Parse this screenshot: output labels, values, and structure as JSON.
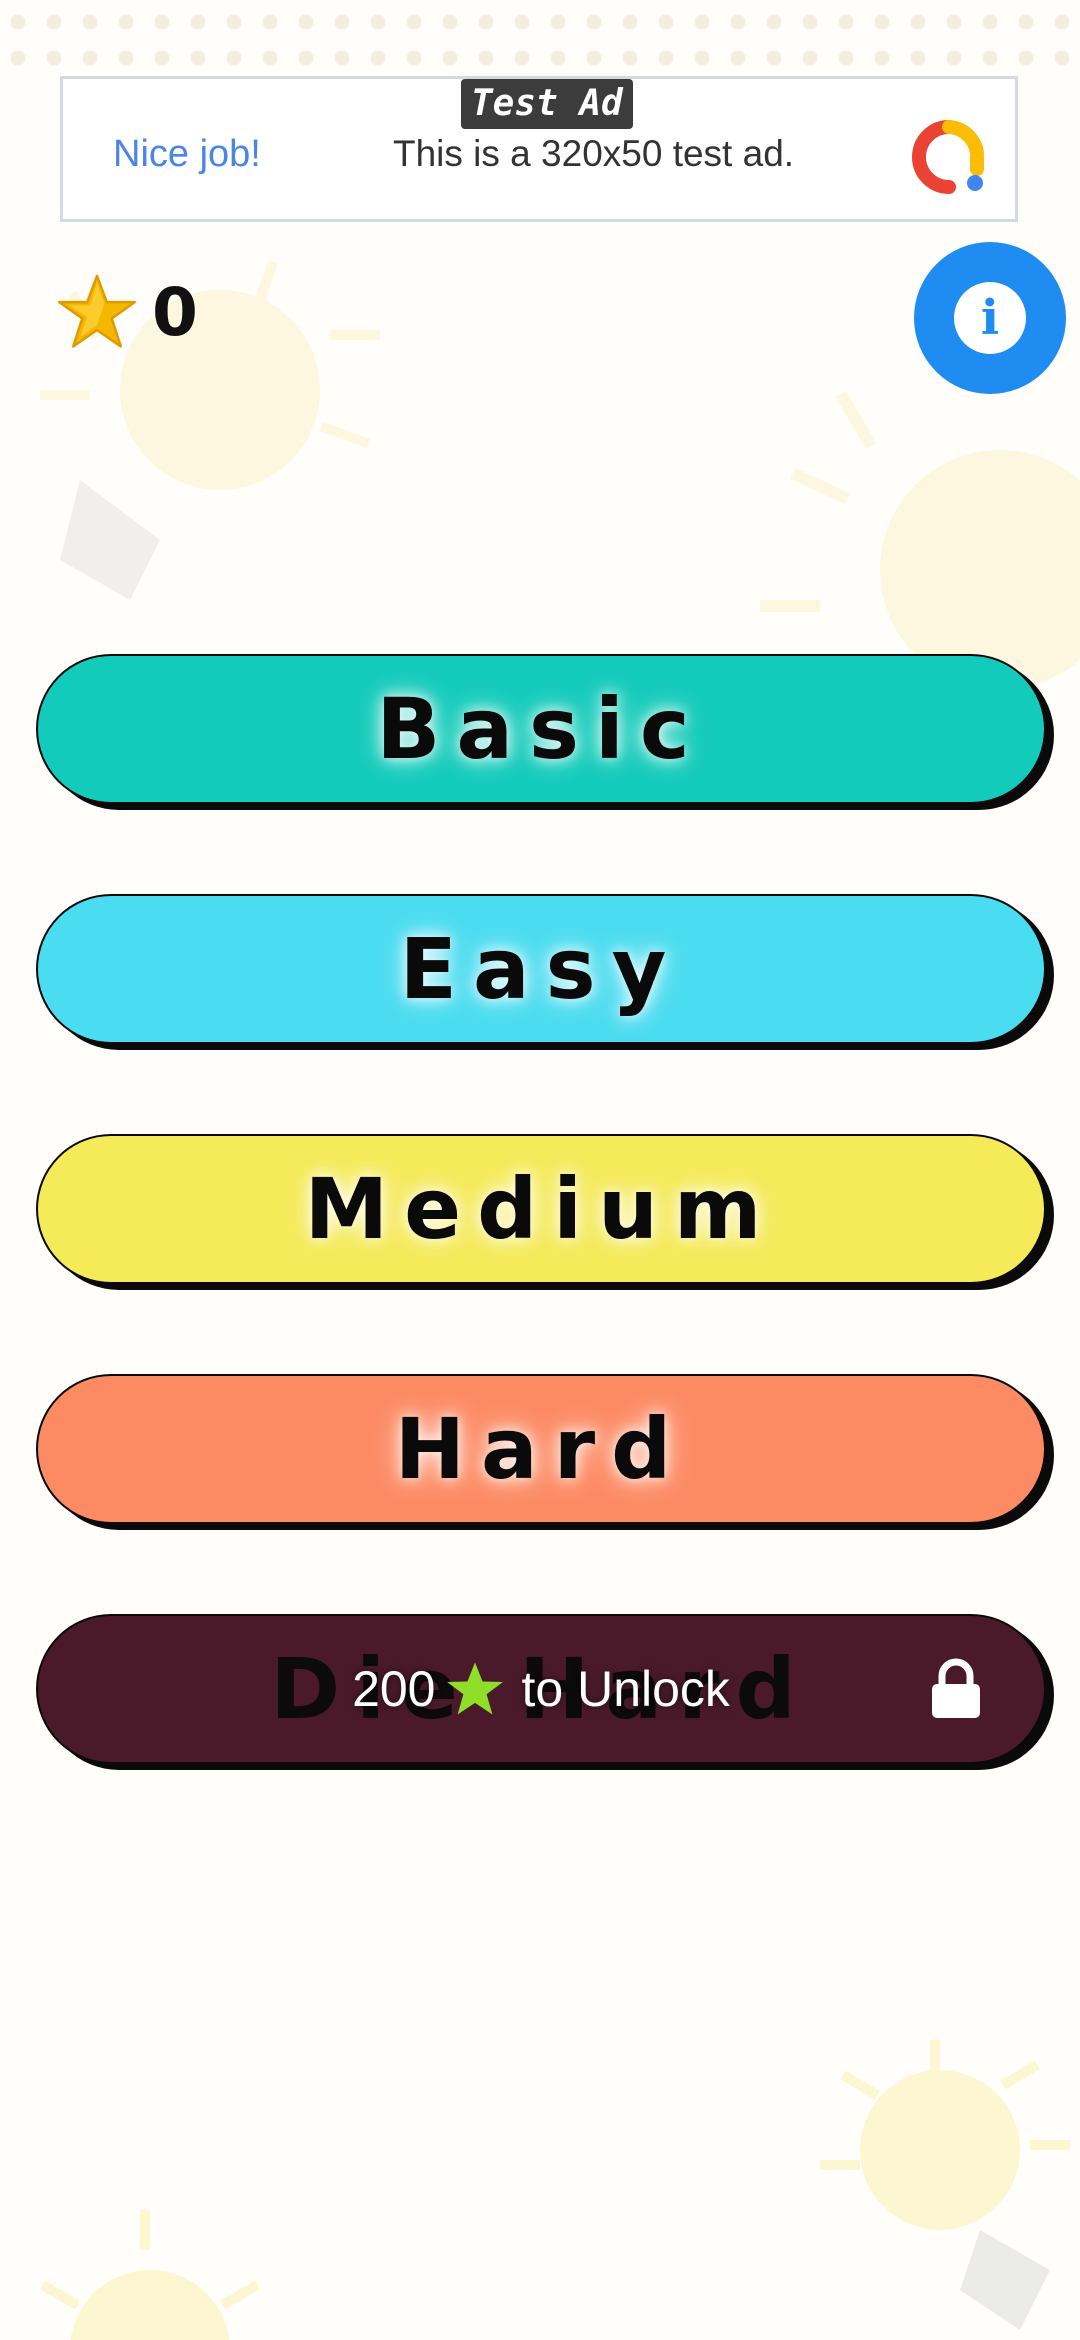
{
  "ad": {
    "tag": "Test Ad",
    "headline": "Nice job!",
    "body": "This is a 320x50 test ad.",
    "logo_icon": "admob-logo-icon"
  },
  "header": {
    "score_icon": "star-icon",
    "score": "0",
    "info_icon": "info-icon"
  },
  "levels": [
    {
      "label": "Basic",
      "color": "#13cbbb"
    },
    {
      "label": "Easy",
      "color": "#4adcf0"
    },
    {
      "label": "Medium",
      "color": "#f5ea58"
    },
    {
      "label": "Hard",
      "color": "#fc8b64"
    },
    {
      "label": "Die Hard",
      "color": "#4a1a2a",
      "locked": true,
      "unlock_cost": "200",
      "unlock_suffix": "to Unlock",
      "lock_icon": "lock-icon"
    }
  ],
  "colors": {
    "accent": "#1e8cf0",
    "star": "#f5b800",
    "unlock_star": "#8fdf2a"
  }
}
